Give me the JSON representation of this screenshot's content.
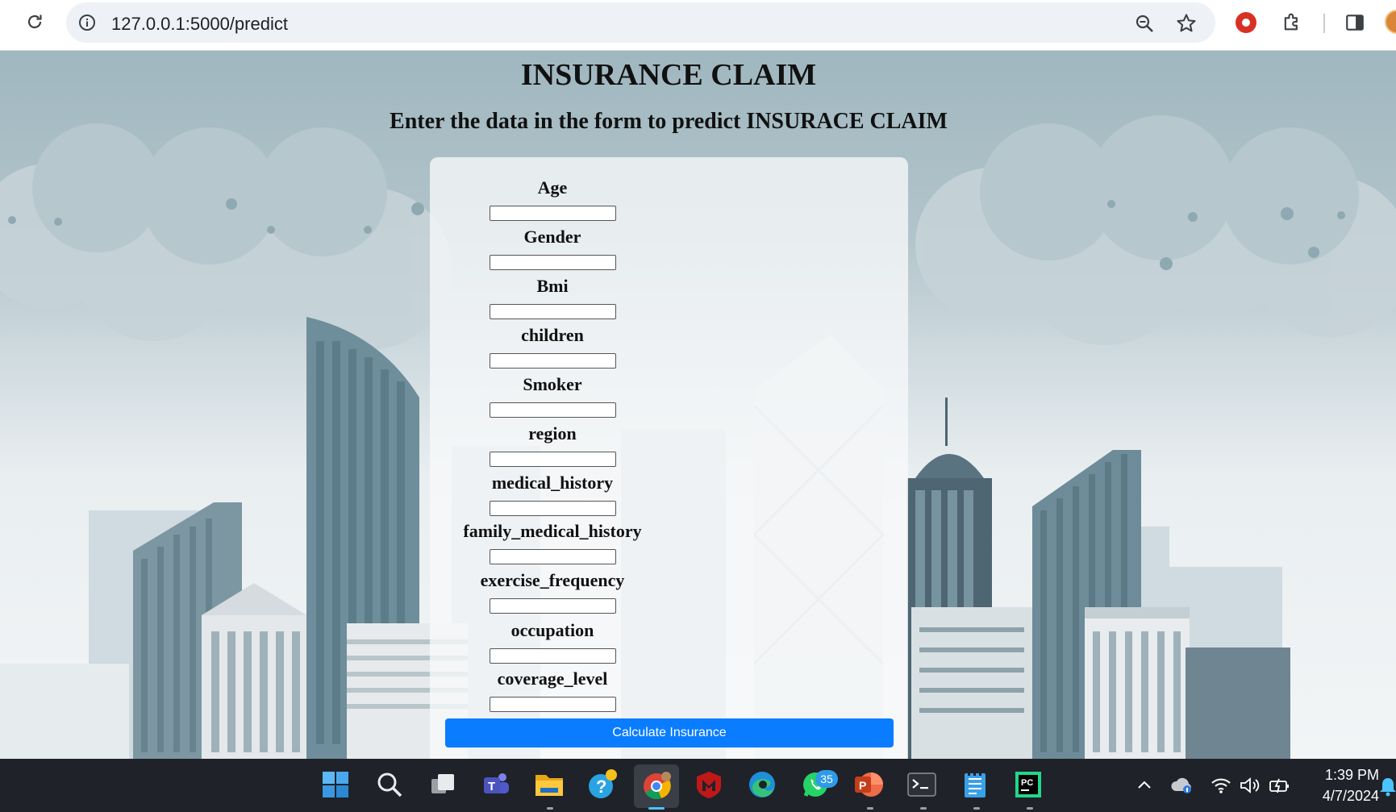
{
  "browser": {
    "url": "127.0.0.1:5000/predict",
    "icons": [
      "reload-icon",
      "site-info-icon",
      "zoom-icon",
      "bookmark-star-icon",
      "extension-red-icon",
      "extensions-puzzle-icon",
      "side-panel-icon",
      "profile-avatar"
    ]
  },
  "page": {
    "title": "INSURANCE CLAIM",
    "subtitle": "Enter the data in the form to predict INSURACE CLAIM",
    "form": {
      "fields": [
        {
          "label": "Age",
          "value": ""
        },
        {
          "label": "Gender",
          "value": ""
        },
        {
          "label": "Bmi",
          "value": ""
        },
        {
          "label": "children",
          "value": ""
        },
        {
          "label": "Smoker",
          "value": ""
        },
        {
          "label": "region",
          "value": ""
        },
        {
          "label": "medical_history",
          "value": ""
        },
        {
          "label": "family_medical_history",
          "value": ""
        },
        {
          "label": "exercise_frequency",
          "value": ""
        },
        {
          "label": "occupation",
          "value": ""
        },
        {
          "label": "coverage_level",
          "value": ""
        }
      ],
      "submit_label": "Calculate Insurance"
    },
    "colors": {
      "button": "#0a7cff",
      "sky": "#a0b7bf"
    }
  },
  "taskbar": {
    "apps": [
      "start",
      "search",
      "task-view",
      "teams",
      "file-explorer",
      "help",
      "chrome",
      "mcafee",
      "edge",
      "whatsapp",
      "powerpoint",
      "terminal",
      "notepad",
      "pycharm"
    ],
    "whatsapp_badge": "35",
    "time": "1:39 PM",
    "date": "4/7/2024"
  }
}
